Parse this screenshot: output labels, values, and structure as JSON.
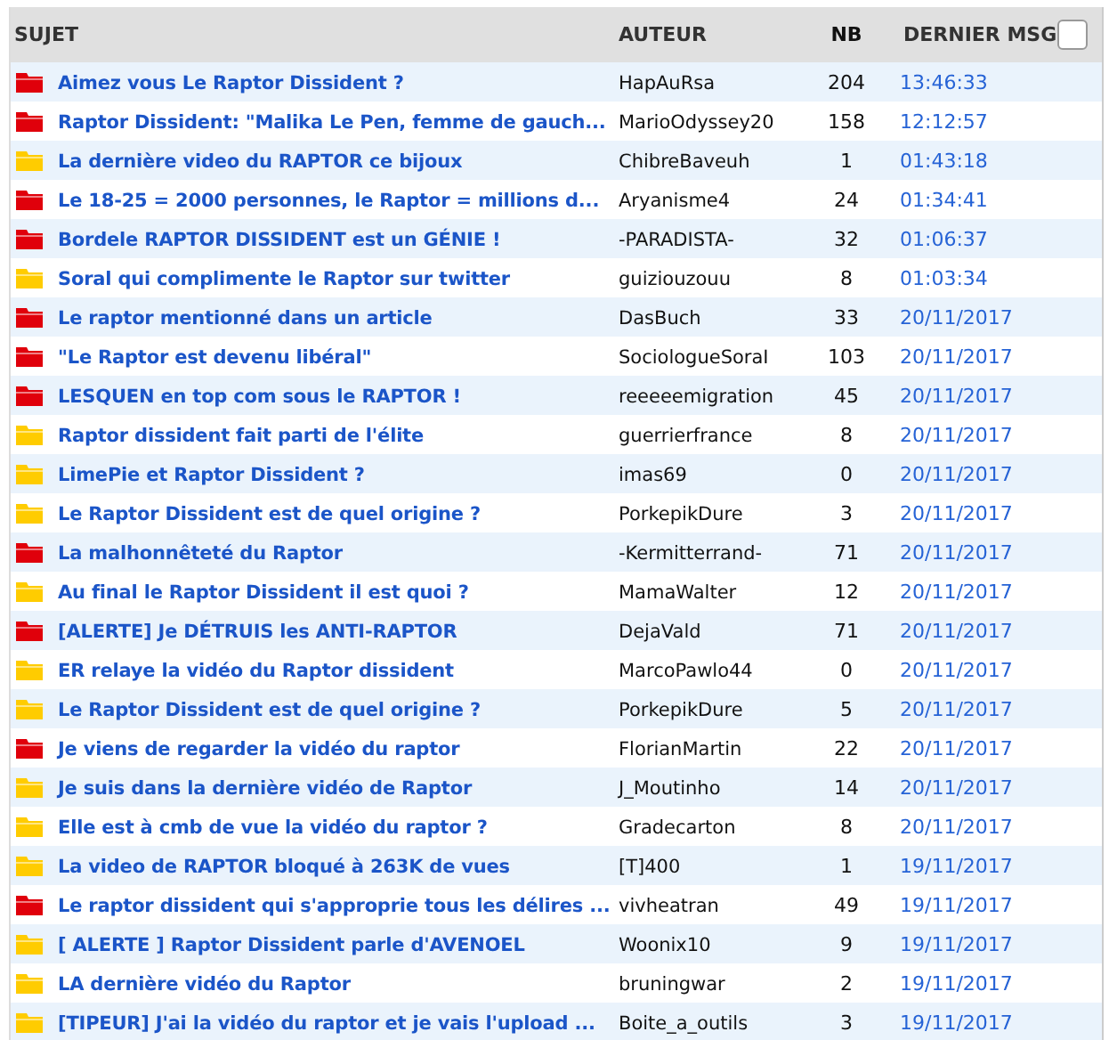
{
  "columns": [
    "SUJET",
    "AUTEUR",
    "NB",
    "DERNIER MSG"
  ],
  "select_all": {
    "checked": false
  },
  "topics": [
    {
      "kind": "hot",
      "subject": "Aimez vous Le Raptor Dissident ?",
      "author": "HapAuRsa",
      "count": "204",
      "last": "13:46:33"
    },
    {
      "kind": "hot",
      "subject": "Raptor Dissident: \"Malika Le Pen, femme de gauch...",
      "author": "MarioOdyssey20",
      "count": "158",
      "last": "12:12:57"
    },
    {
      "kind": "normal",
      "subject": "La dernière video du RAPTOR ce bijoux",
      "author": "ChibreBaveuh",
      "count": "1",
      "last": "01:43:18"
    },
    {
      "kind": "hot",
      "subject": "Le 18-25 = 2000 personnes, le Raptor = millions d...",
      "author": "Aryanisme4",
      "count": "24",
      "last": "01:34:41"
    },
    {
      "kind": "hot",
      "subject": "Bordele RAPTOR DISSIDENT est un GÉNIE !",
      "author": "-PARADISTA-",
      "count": "32",
      "last": "01:06:37"
    },
    {
      "kind": "normal",
      "subject": "Soral qui complimente le Raptor sur twitter",
      "author": "guiziouzouu",
      "count": "8",
      "last": "01:03:34"
    },
    {
      "kind": "hot",
      "subject": "Le raptor mentionné dans un article",
      "author": "DasBuch",
      "count": "33",
      "last": "20/11/2017"
    },
    {
      "kind": "hot",
      "subject": "\"Le Raptor est devenu libéral\"",
      "author": "SociologueSoraI",
      "count": "103",
      "last": "20/11/2017"
    },
    {
      "kind": "hot",
      "subject": "LESQUEN en top com sous le RAPTOR !",
      "author": "reeeeemigration",
      "count": "45",
      "last": "20/11/2017"
    },
    {
      "kind": "normal",
      "subject": "Raptor dissident fait parti de l'élite",
      "author": "guerrierfrance",
      "count": "8",
      "last": "20/11/2017"
    },
    {
      "kind": "normal",
      "subject": "LimePie et Raptor Dissident ?",
      "author": "imas69",
      "count": "0",
      "last": "20/11/2017"
    },
    {
      "kind": "normal",
      "subject": "Le Raptor Dissident est de quel origine ?",
      "author": "PorkepikDure",
      "count": "3",
      "last": "20/11/2017"
    },
    {
      "kind": "hot",
      "subject": "La malhonnêteté du Raptor",
      "author": "-Kermitterrand-",
      "count": "71",
      "last": "20/11/2017"
    },
    {
      "kind": "normal",
      "subject": "Au final le Raptor Dissident il est quoi ?",
      "author": "MamaWalter",
      "count": "12",
      "last": "20/11/2017"
    },
    {
      "kind": "hot",
      "subject": "[ALERTE] Je DÉTRUIS les ANTI-RAPTOR",
      "author": "DejaVald",
      "count": "71",
      "last": "20/11/2017"
    },
    {
      "kind": "normal",
      "subject": "ER relaye la vidéo du Raptor dissident",
      "author": "MarcoPawlo44",
      "count": "0",
      "last": "20/11/2017"
    },
    {
      "kind": "normal",
      "subject": "Le Raptor Dissident est de quel origine ?",
      "author": "PorkepikDure",
      "count": "5",
      "last": "20/11/2017"
    },
    {
      "kind": "hot",
      "subject": "Je viens de regarder la vidéo du raptor",
      "author": "FlorianMartin",
      "count": "22",
      "last": "20/11/2017"
    },
    {
      "kind": "normal",
      "subject": "Je suis dans la dernière vidéo de Raptor",
      "author": "J_Moutinho",
      "count": "14",
      "last": "20/11/2017"
    },
    {
      "kind": "normal",
      "subject": "Elle est à cmb de vue la vidéo du raptor ?",
      "author": "Gradecarton",
      "count": "8",
      "last": "20/11/2017"
    },
    {
      "kind": "normal",
      "subject": "La video de RAPTOR bloqué à 263K de vues",
      "author": "[T]400",
      "count": "1",
      "last": "19/11/2017"
    },
    {
      "kind": "hot",
      "subject": "Le raptor dissident qui s'approprie tous les délires ...",
      "author": "vivheatran",
      "count": "49",
      "last": "19/11/2017"
    },
    {
      "kind": "normal",
      "subject": "[ ALERTE ] Raptor Dissident parle d'AVENOEL",
      "author": "Woonix10",
      "count": "9",
      "last": "19/11/2017"
    },
    {
      "kind": "normal",
      "subject": "LA dernière vidéo du Raptor",
      "author": "bruningwar",
      "count": "2",
      "last": "19/11/2017"
    },
    {
      "kind": "normal",
      "subject": "[TIPEUR] J'ai la vidéo du raptor et je vais l'upload ...",
      "author": "Boite_a_outils",
      "count": "3",
      "last": "19/11/2017"
    }
  ]
}
